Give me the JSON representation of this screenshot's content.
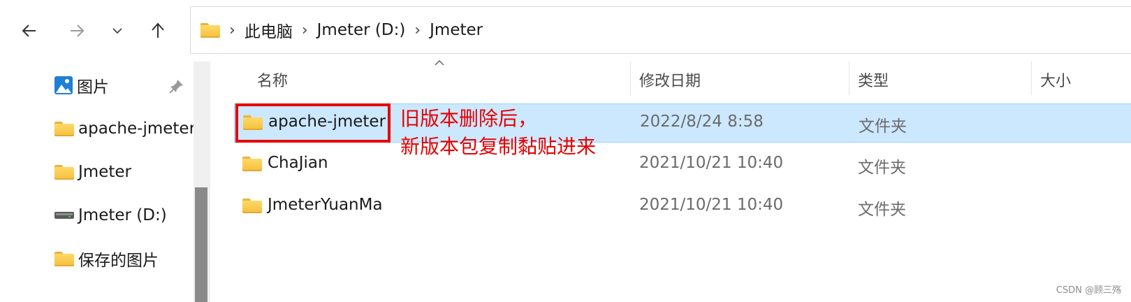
{
  "breadcrumb": {
    "items": [
      "此电脑",
      "Jmeter (D:)",
      "Jmeter"
    ]
  },
  "sidebar": {
    "items": [
      {
        "label": "图片",
        "icon": "pictures-icon",
        "pinned": true
      },
      {
        "label": "apache-jmeter",
        "icon": "folder-icon"
      },
      {
        "label": "Jmeter",
        "icon": "folder-icon"
      },
      {
        "label": "Jmeter (D:)",
        "icon": "drive-icon"
      },
      {
        "label": "保存的图片",
        "icon": "folder-icon"
      }
    ]
  },
  "columns": {
    "name": "名称",
    "date": "修改日期",
    "type": "类型",
    "size": "大小"
  },
  "files": [
    {
      "name": "apache-jmeter",
      "date": "2022/8/24 8:58",
      "type": "文件夹",
      "selected": true
    },
    {
      "name": "ChaJian",
      "date": "2021/10/21 10:40",
      "type": "文件夹",
      "selected": false
    },
    {
      "name": "JmeterYuanMa",
      "date": "2021/10/21 10:40",
      "type": "文件夹",
      "selected": false
    }
  ],
  "annotation": {
    "line1": "旧版本删除后，",
    "line2": "新版本包复制黏贴进来",
    "color": "#e60000"
  },
  "watermark": "CSDN @顾三殇",
  "colors": {
    "selection": "#cce8ff",
    "folder": "#f5bf3e"
  }
}
